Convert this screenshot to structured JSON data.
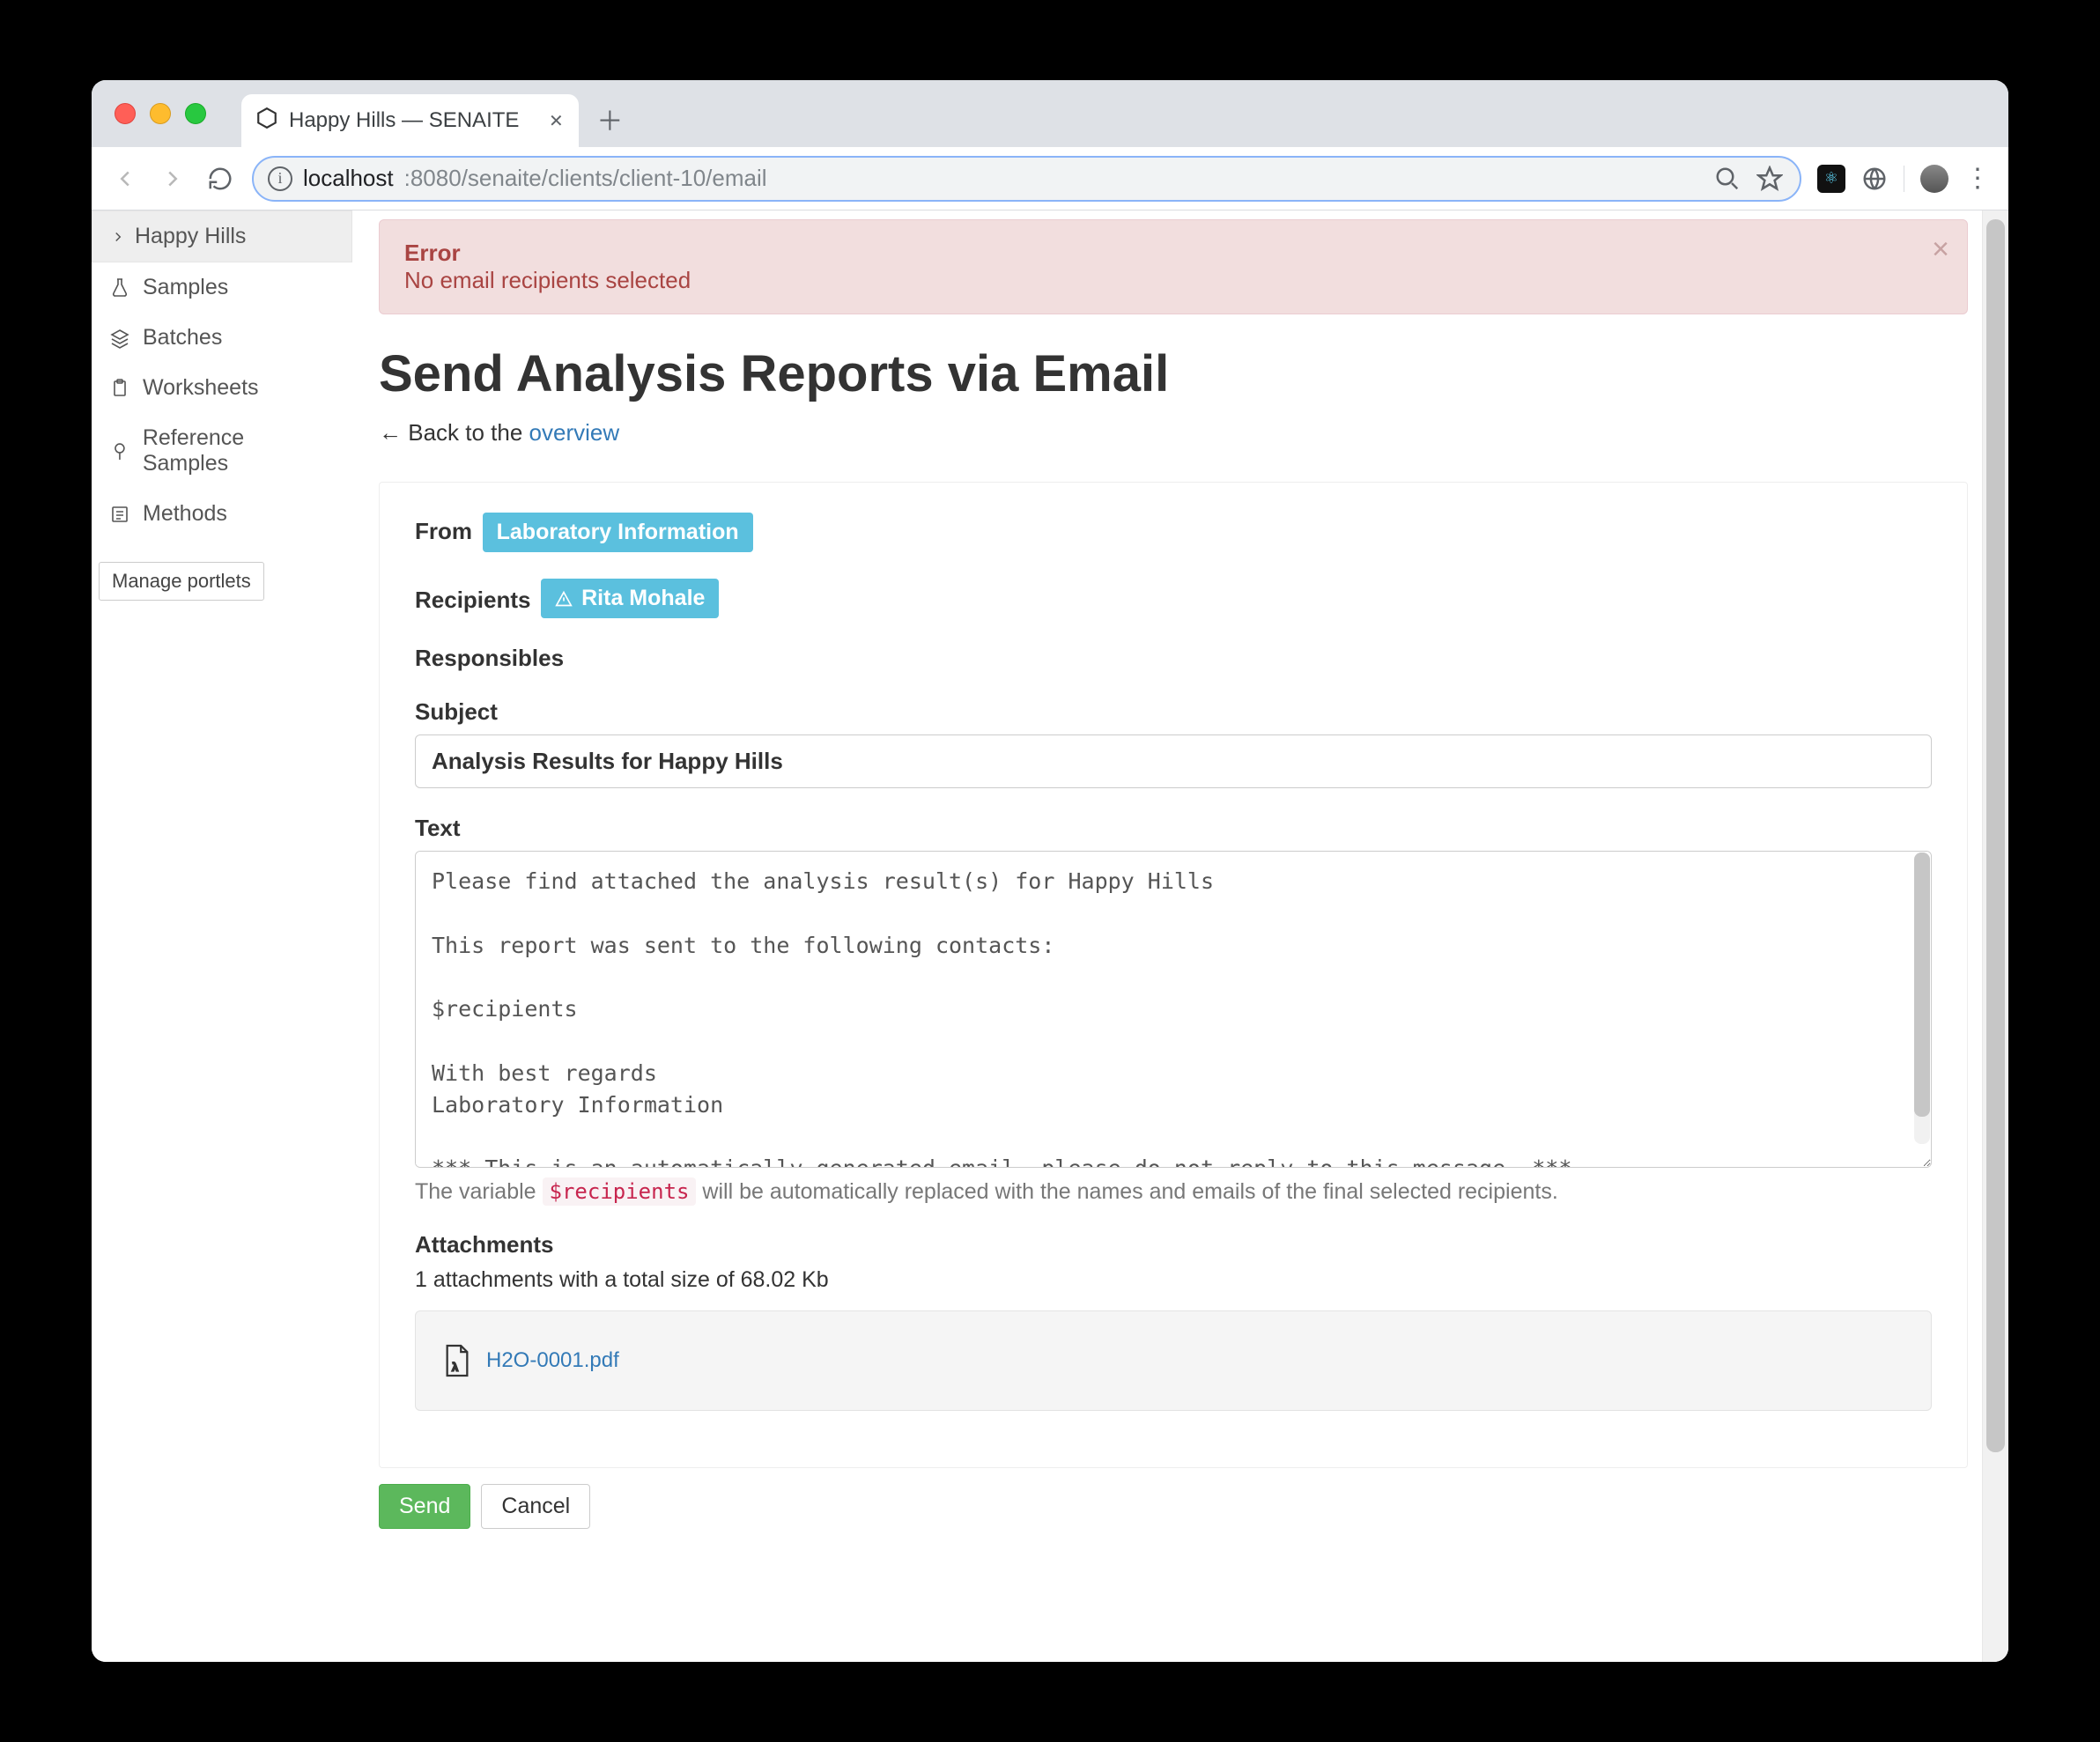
{
  "browser": {
    "tab_title": "Happy Hills — SENAITE",
    "url_host": "localhost",
    "url_port_path": ":8080/senaite/clients/client-10/email"
  },
  "sidebar": {
    "client": "Happy Hills",
    "items": [
      {
        "label": "Samples"
      },
      {
        "label": "Batches"
      },
      {
        "label": "Worksheets"
      },
      {
        "label": "Reference Samples"
      },
      {
        "label": "Methods"
      }
    ],
    "manage_portlets": "Manage portlets"
  },
  "alert": {
    "title": "Error",
    "message": "No email recipients selected"
  },
  "page": {
    "title": "Send Analysis Reports via Email",
    "back_prefix": "← Back to the ",
    "back_link": "overview"
  },
  "form": {
    "from_label": "From",
    "from_value": "Laboratory Information",
    "recipients_label": "Recipients",
    "recipients_value": "Rita Mohale",
    "responsibles_label": "Responsibles",
    "subject_label": "Subject",
    "subject_value": "Analysis Results for Happy Hills",
    "text_label": "Text",
    "text_value": "Please find attached the analysis result(s) for Happy Hills\n\nThis report was sent to the following contacts:\n\n$recipients\n\nWith best regards\nLaboratory Information\n\n*** This is an automatically generated email, please do not reply to this message. ***",
    "hint_pre": "The variable ",
    "hint_var": "$recipients",
    "hint_post": " will be automatically replaced with the names and emails of the final selected recipients.",
    "attachments_label": "Attachments",
    "attachments_summary": "1 attachments with a total size of 68.02 Kb",
    "attachment_filename": "H2O-0001.pdf",
    "send": "Send",
    "cancel": "Cancel"
  }
}
